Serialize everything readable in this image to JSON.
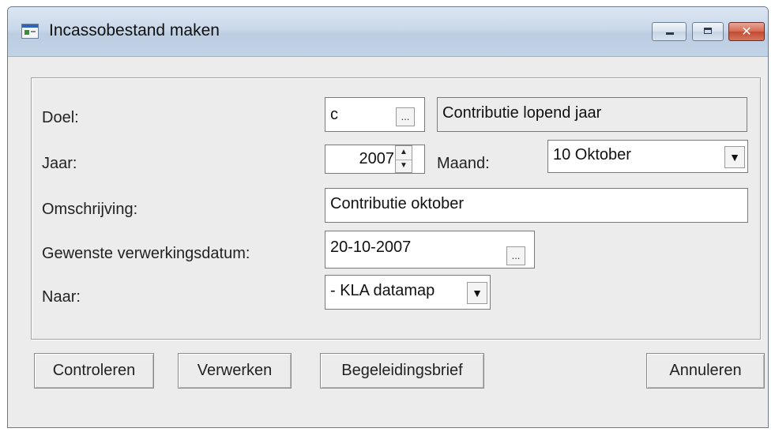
{
  "window": {
    "title": "Incassobestand maken",
    "close_glyph": "✕"
  },
  "form": {
    "doel": {
      "label": "Doel:",
      "code": "c",
      "browse_label": "...",
      "description": "Contributie lopend jaar"
    },
    "jaar": {
      "label": "Jaar:",
      "value": "2007",
      "spin_up": "▲",
      "spin_down": "▼"
    },
    "maand": {
      "label": "Maand:",
      "value": "10 Oktober",
      "arrow": "▼"
    },
    "omschrijving": {
      "label": "Omschrijving:",
      "value": "Contributie oktober"
    },
    "verwerkingsdatum": {
      "label": "Gewenste verwerkingsdatum:",
      "value": "20-10-2007",
      "browse_label": "..."
    },
    "naar": {
      "label": "Naar:",
      "value": "- KLA datamap",
      "arrow": "▼"
    }
  },
  "buttons": {
    "controleren": "Controleren",
    "verwerken": "Verwerken",
    "begeleidingsbrief": "Begeleidingsbrief",
    "annuleren": "Annuleren"
  },
  "colors": {
    "titlebar": "#c9d8ea",
    "close_button": "#c24a30",
    "dialog_background": "#ececec"
  }
}
